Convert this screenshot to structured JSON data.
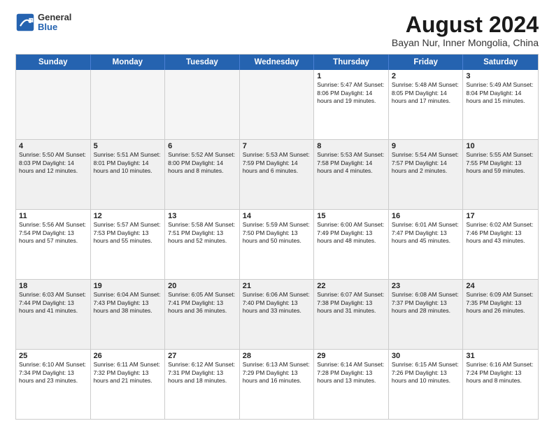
{
  "header": {
    "logo_line1": "General",
    "logo_line2": "Blue",
    "title": "August 2024",
    "subtitle": "Bayan Nur, Inner Mongolia, China"
  },
  "calendar": {
    "weekdays": [
      "Sunday",
      "Monday",
      "Tuesday",
      "Wednesday",
      "Thursday",
      "Friday",
      "Saturday"
    ],
    "weeks": [
      [
        {
          "day": "",
          "info": "",
          "empty": true
        },
        {
          "day": "",
          "info": "",
          "empty": true
        },
        {
          "day": "",
          "info": "",
          "empty": true
        },
        {
          "day": "",
          "info": "",
          "empty": true
        },
        {
          "day": "1",
          "info": "Sunrise: 5:47 AM\nSunset: 8:06 PM\nDaylight: 14 hours\nand 19 minutes."
        },
        {
          "day": "2",
          "info": "Sunrise: 5:48 AM\nSunset: 8:05 PM\nDaylight: 14 hours\nand 17 minutes."
        },
        {
          "day": "3",
          "info": "Sunrise: 5:49 AM\nSunset: 8:04 PM\nDaylight: 14 hours\nand 15 minutes."
        }
      ],
      [
        {
          "day": "4",
          "info": "Sunrise: 5:50 AM\nSunset: 8:03 PM\nDaylight: 14 hours\nand 12 minutes."
        },
        {
          "day": "5",
          "info": "Sunrise: 5:51 AM\nSunset: 8:01 PM\nDaylight: 14 hours\nand 10 minutes."
        },
        {
          "day": "6",
          "info": "Sunrise: 5:52 AM\nSunset: 8:00 PM\nDaylight: 14 hours\nand 8 minutes."
        },
        {
          "day": "7",
          "info": "Sunrise: 5:53 AM\nSunset: 7:59 PM\nDaylight: 14 hours\nand 6 minutes."
        },
        {
          "day": "8",
          "info": "Sunrise: 5:53 AM\nSunset: 7:58 PM\nDaylight: 14 hours\nand 4 minutes."
        },
        {
          "day": "9",
          "info": "Sunrise: 5:54 AM\nSunset: 7:57 PM\nDaylight: 14 hours\nand 2 minutes."
        },
        {
          "day": "10",
          "info": "Sunrise: 5:55 AM\nSunset: 7:55 PM\nDaylight: 13 hours\nand 59 minutes."
        }
      ],
      [
        {
          "day": "11",
          "info": "Sunrise: 5:56 AM\nSunset: 7:54 PM\nDaylight: 13 hours\nand 57 minutes."
        },
        {
          "day": "12",
          "info": "Sunrise: 5:57 AM\nSunset: 7:53 PM\nDaylight: 13 hours\nand 55 minutes."
        },
        {
          "day": "13",
          "info": "Sunrise: 5:58 AM\nSunset: 7:51 PM\nDaylight: 13 hours\nand 52 minutes."
        },
        {
          "day": "14",
          "info": "Sunrise: 5:59 AM\nSunset: 7:50 PM\nDaylight: 13 hours\nand 50 minutes."
        },
        {
          "day": "15",
          "info": "Sunrise: 6:00 AM\nSunset: 7:49 PM\nDaylight: 13 hours\nand 48 minutes."
        },
        {
          "day": "16",
          "info": "Sunrise: 6:01 AM\nSunset: 7:47 PM\nDaylight: 13 hours\nand 45 minutes."
        },
        {
          "day": "17",
          "info": "Sunrise: 6:02 AM\nSunset: 7:46 PM\nDaylight: 13 hours\nand 43 minutes."
        }
      ],
      [
        {
          "day": "18",
          "info": "Sunrise: 6:03 AM\nSunset: 7:44 PM\nDaylight: 13 hours\nand 41 minutes."
        },
        {
          "day": "19",
          "info": "Sunrise: 6:04 AM\nSunset: 7:43 PM\nDaylight: 13 hours\nand 38 minutes."
        },
        {
          "day": "20",
          "info": "Sunrise: 6:05 AM\nSunset: 7:41 PM\nDaylight: 13 hours\nand 36 minutes."
        },
        {
          "day": "21",
          "info": "Sunrise: 6:06 AM\nSunset: 7:40 PM\nDaylight: 13 hours\nand 33 minutes."
        },
        {
          "day": "22",
          "info": "Sunrise: 6:07 AM\nSunset: 7:38 PM\nDaylight: 13 hours\nand 31 minutes."
        },
        {
          "day": "23",
          "info": "Sunrise: 6:08 AM\nSunset: 7:37 PM\nDaylight: 13 hours\nand 28 minutes."
        },
        {
          "day": "24",
          "info": "Sunrise: 6:09 AM\nSunset: 7:35 PM\nDaylight: 13 hours\nand 26 minutes."
        }
      ],
      [
        {
          "day": "25",
          "info": "Sunrise: 6:10 AM\nSunset: 7:34 PM\nDaylight: 13 hours\nand 23 minutes."
        },
        {
          "day": "26",
          "info": "Sunrise: 6:11 AM\nSunset: 7:32 PM\nDaylight: 13 hours\nand 21 minutes."
        },
        {
          "day": "27",
          "info": "Sunrise: 6:12 AM\nSunset: 7:31 PM\nDaylight: 13 hours\nand 18 minutes."
        },
        {
          "day": "28",
          "info": "Sunrise: 6:13 AM\nSunset: 7:29 PM\nDaylight: 13 hours\nand 16 minutes."
        },
        {
          "day": "29",
          "info": "Sunrise: 6:14 AM\nSunset: 7:28 PM\nDaylight: 13 hours\nand 13 minutes."
        },
        {
          "day": "30",
          "info": "Sunrise: 6:15 AM\nSunset: 7:26 PM\nDaylight: 13 hours\nand 10 minutes."
        },
        {
          "day": "31",
          "info": "Sunrise: 6:16 AM\nSunset: 7:24 PM\nDaylight: 13 hours\nand 8 minutes."
        }
      ]
    ]
  }
}
